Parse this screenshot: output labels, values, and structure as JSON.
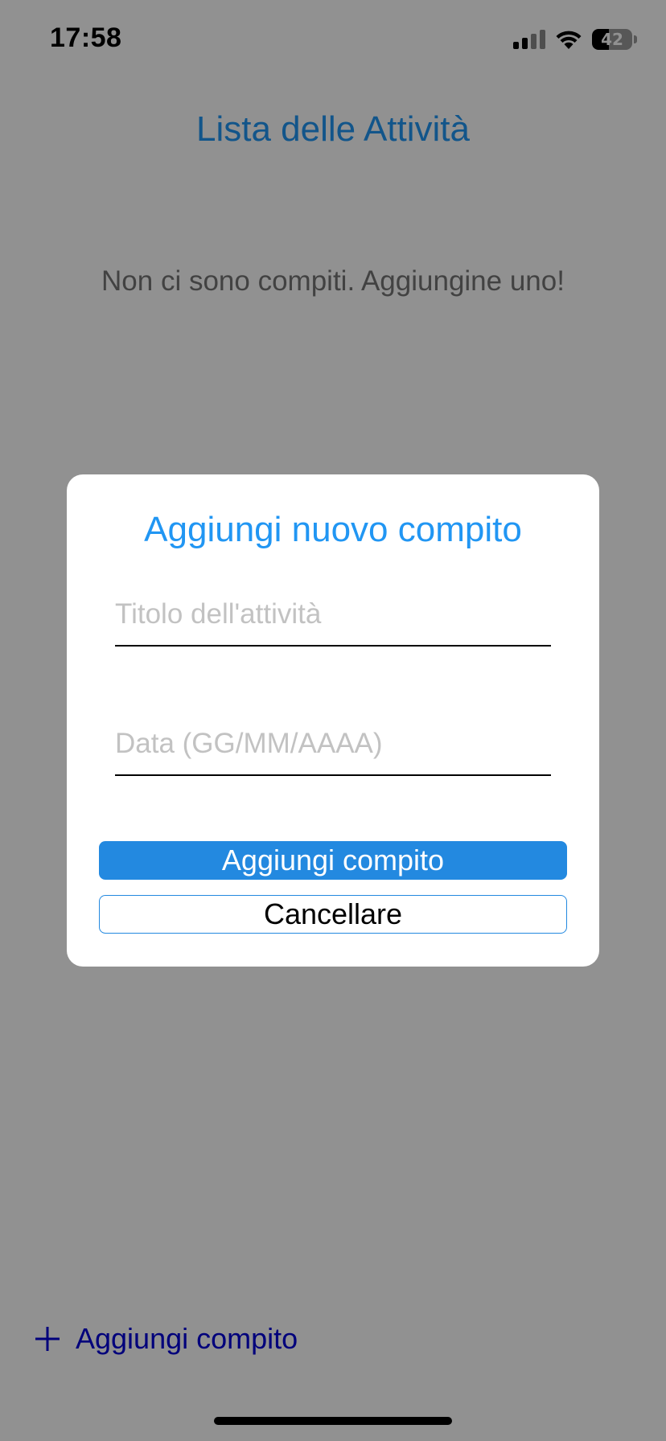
{
  "status_bar": {
    "time": "17:58",
    "battery_level": "42",
    "icons": [
      "cellular-signal-icon",
      "wifi-icon",
      "battery-icon"
    ]
  },
  "page": {
    "title": "Lista delle Attività",
    "empty_message": "Non ci sono compiti. Aggiungine uno!",
    "add_task_label": "Aggiungi compito",
    "add_icon": "plus-icon"
  },
  "modal": {
    "title": "Aggiungi nuovo compito",
    "title_field": {
      "placeholder": "Titolo dell'attività",
      "value": ""
    },
    "date_field": {
      "placeholder": "Data (GG/MM/AAAA)",
      "value": ""
    },
    "add_button_label": "Aggiungi compito",
    "cancel_button_label": "Cancellare"
  },
  "colors": {
    "accent": "#2196f3",
    "primary_button": "#2389e0",
    "link": "#0000d8",
    "muted_text": "#757575",
    "placeholder": "#c2c2c2"
  }
}
